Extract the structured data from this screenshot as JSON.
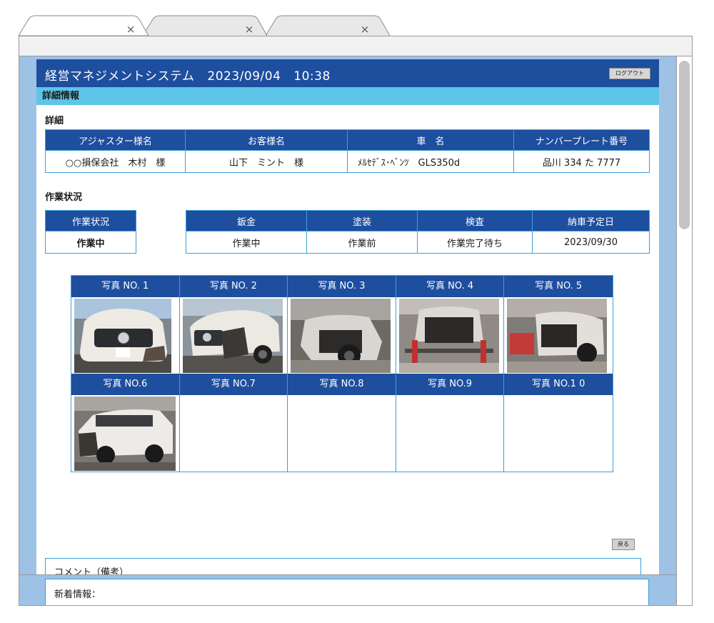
{
  "browser": {
    "tabs": [
      {
        "close": "×"
      },
      {
        "close": "×"
      },
      {
        "close": "×"
      }
    ]
  },
  "header": {
    "title": "経営マネジメントシステム",
    "date": "2023/09/04",
    "time": "10:38",
    "logout_label": "ログアウト"
  },
  "subheader": {
    "title": "詳細情報"
  },
  "details": {
    "section_label": "詳細",
    "columns": [
      "アジャスター様名",
      "お客様名",
      "車　名",
      "ナンバープレート番号"
    ],
    "values": [
      "○○損保会社　木村　様",
      "山下　ミント　様",
      "ﾒﾙｾﾃﾞｽ･ﾍﾞﾝﾂ　GLS350d",
      "品川 334 た 7777"
    ]
  },
  "work_status": {
    "section_label": "作業状況",
    "status_header": "作業状況",
    "status_value": "作業中",
    "status_color": "#c4dc8a",
    "columns": [
      "鈑金",
      "塗装",
      "検査",
      "納車予定日"
    ],
    "values": [
      "作業中",
      "作業前",
      "作業完了待ち",
      "2023/09/30"
    ]
  },
  "photos": {
    "row1": [
      {
        "label": "写真 NO. 1",
        "has_image": true
      },
      {
        "label": "写真 NO. 2",
        "has_image": true
      },
      {
        "label": "写真 NO. 3",
        "has_image": true
      },
      {
        "label": "写真 NO. 4",
        "has_image": true
      },
      {
        "label": "写真 NO. 5",
        "has_image": true
      }
    ],
    "row2": [
      {
        "label": "写真 NO.6",
        "has_image": true
      },
      {
        "label": "写真 NO.7",
        "has_image": false
      },
      {
        "label": "写真 NO.8",
        "has_image": false
      },
      {
        "label": "写真 NO.9",
        "has_image": false
      },
      {
        "label": "写真 NO.1 0",
        "has_image": false
      }
    ]
  },
  "back_label": "戻る",
  "comment": {
    "label": "コメント（備考）"
  },
  "news": {
    "label": "新着情報："
  },
  "colors": {
    "header_blue": "#1e4e9e",
    "subheader_cyan": "#5dc5e8",
    "border_blue": "#3aa0dc",
    "frame_bg": "#9dc2e6"
  }
}
